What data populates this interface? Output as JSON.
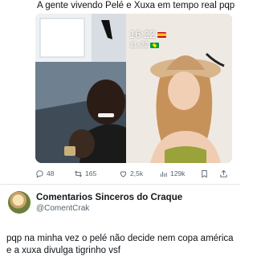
{
  "post": {
    "caption": "A gente vivendo Pelé e Xuxa em tempo real pqp",
    "media": {
      "overlay_time_1": "16:22",
      "overlay_time_2": "11:22",
      "flags": [
        "spain-flag",
        "brazil-flag"
      ]
    },
    "actions": {
      "replies": "48",
      "reposts": "165",
      "likes": "2,5k",
      "views": "129k"
    }
  },
  "reply": {
    "author_name": "Comentarios Sinceros do Craque",
    "author_handle": "@ComentCrak",
    "text": "pqp na minha vez o pelé não decide nem copa américa e a xuxa divulga tigrinho vsf"
  },
  "icons": {
    "reply": "reply-icon",
    "repost": "repost-icon",
    "like": "heart-icon",
    "views": "views-icon",
    "bookmark": "bookmark-icon",
    "share": "share-icon"
  },
  "colors": {
    "text": "#14171a",
    "muted": "#536471"
  }
}
